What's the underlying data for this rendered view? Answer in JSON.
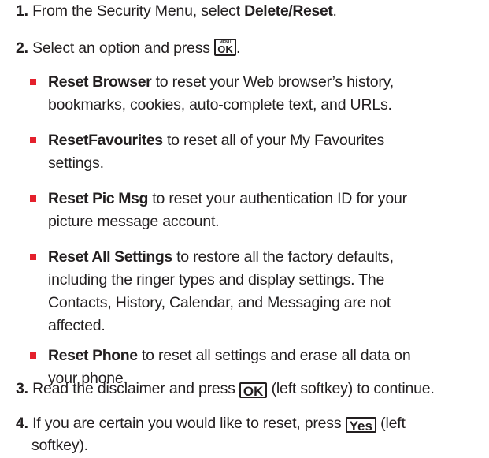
{
  "steps": [
    {
      "num": "1.",
      "pre": "From the Security Menu, select ",
      "bold": "Delete/Reset",
      "post": "."
    },
    {
      "num": "2.",
      "pre": "Select an option and press ",
      "key_top": "MENU",
      "key_main": "OK",
      "post": "."
    },
    {
      "num": "3.",
      "pre": "Read the disclaimer and press ",
      "key": "OK",
      "post": " (left softkey) to continue."
    },
    {
      "num": "4.",
      "pre": "If you are certain you would like to reset, press ",
      "key": "Yes",
      "post_line1": " (left",
      "post_line2": "softkey)."
    }
  ],
  "options": [
    {
      "term": "Reset Browser",
      "line1": " to reset your Web browser’s history,",
      "line2": "bookmarks, cookies, auto-complete text, and URLs."
    },
    {
      "term": "ResetFavourites",
      "line1": " to reset all of your My Favourites",
      "line2": "settings."
    },
    {
      "term": "Reset Pic Msg",
      "line1": " to reset your authentication ID for your",
      "line2": "picture message account."
    },
    {
      "term": "Reset All Settings",
      "line1": " to restore all the factory defaults,",
      "line2": "including the ringer types and display settings. The",
      "line3": "Contacts, History, Calendar, and Messaging are not",
      "line4": "affected."
    },
    {
      "term": "Reset Phone",
      "line1": " to reset all settings and erase all data on",
      "line2": "your phone."
    }
  ],
  "colors": {
    "bullet": "#e4202c",
    "text": "#231f20"
  }
}
